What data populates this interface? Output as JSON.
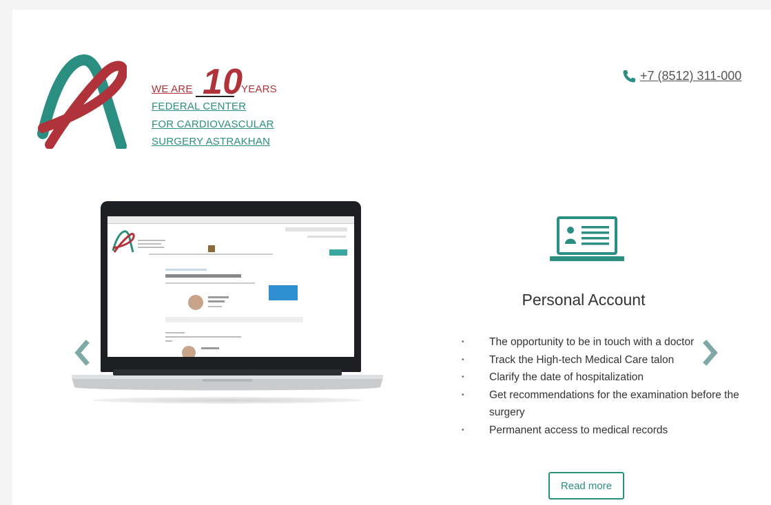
{
  "logo": {
    "we_are": "WE ARE",
    "number": "10",
    "years": "YEARS",
    "line2": "FEDERAL CENTER",
    "line3": "FOR CARDIOVASCULAR",
    "line4": "SURGERY ASTRAKHAN"
  },
  "header": {
    "phone": "+7 (8512) 311-000"
  },
  "slide": {
    "title": "Personal Account",
    "features": [
      "The opportunity to be in touch with a doctor",
      "Track the High-tech Medical Care talon",
      "Clarify the date of hospitalization",
      "Get recommendations for the examination before the surgery",
      "Permanent access to medical records"
    ],
    "button_label": "Read more"
  },
  "colors": {
    "brand_red": "#b0323a",
    "brand_teal": "#2a8e80",
    "arrow": "#7fa9a8"
  },
  "icons": [
    "phone-icon",
    "account-card-icon",
    "arrow-left-icon",
    "arrow-right-icon",
    "logo-mark-icon"
  ]
}
